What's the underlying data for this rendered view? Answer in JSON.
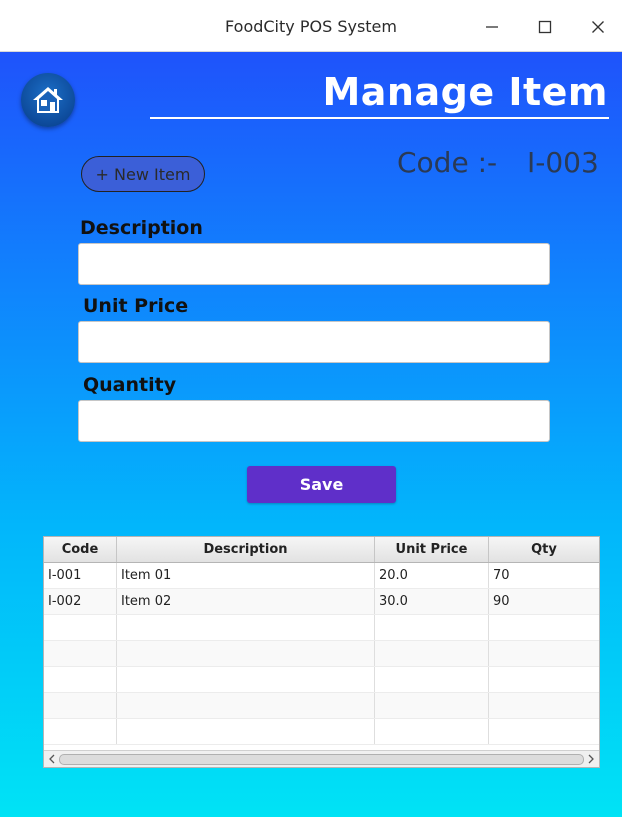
{
  "window": {
    "title": "FoodCity POS System"
  },
  "header": {
    "title": "Manage Item",
    "home_icon": "home-icon"
  },
  "form": {
    "new_item_label": "+ New Item",
    "code_label": "Code  :-",
    "code_value": "I-003",
    "description_label": "Description",
    "description_value": "",
    "unit_price_label": "Unit Price",
    "unit_price_value": "",
    "quantity_label": "Quantity",
    "quantity_value": "",
    "save_label": "Save"
  },
  "table": {
    "columns": [
      "Code",
      "Description",
      "Unit Price",
      "Qty"
    ],
    "rows": [
      [
        "I-001",
        "Item 01",
        "20.0",
        "70"
      ],
      [
        "I-002",
        "Item 02",
        "30.0",
        "90"
      ],
      [
        "",
        "",
        "",
        ""
      ],
      [
        "",
        "",
        "",
        ""
      ],
      [
        "",
        "",
        "",
        ""
      ],
      [
        "",
        "",
        "",
        ""
      ],
      [
        "",
        "",
        "",
        ""
      ]
    ]
  },
  "colors": {
    "accent": "#5f2fc9",
    "gradient_top": "#1f53fb",
    "gradient_bottom": "#00e3f5"
  }
}
